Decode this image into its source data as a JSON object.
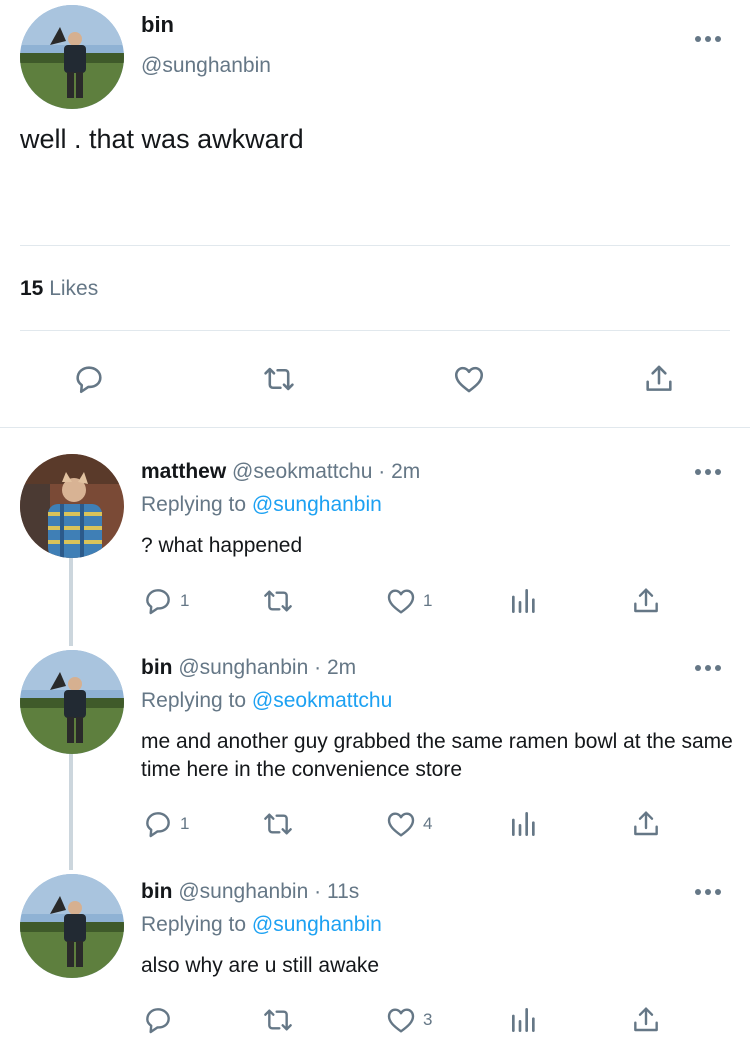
{
  "main_tweet": {
    "name": "bin",
    "handle": "@sunghanbin",
    "text": "well . that was awkward",
    "likes_count": "15",
    "likes_label": "Likes"
  },
  "replies": [
    {
      "name": "matthew",
      "handle": "@seokmattchu",
      "separator": "·",
      "time": "2m",
      "replying_prefix": "Replying to",
      "replying_to": "@sunghanbin",
      "text": "? what happened",
      "reply_count": "1",
      "like_count": "1"
    },
    {
      "name": "bin",
      "handle": "@sunghanbin",
      "separator": "·",
      "time": "2m",
      "replying_prefix": "Replying to",
      "replying_to": "@seokmattchu",
      "text": "me and another guy grabbed the same ramen bowl at the same time here in the convenience store",
      "reply_count": "1",
      "like_count": "4"
    },
    {
      "name": "bin",
      "handle": "@sunghanbin",
      "separator": "·",
      "time": "11s",
      "replying_prefix": "Replying to",
      "replying_to": "@sunghanbin",
      "text": "also why are u still awake",
      "reply_count": "",
      "like_count": "3"
    }
  ],
  "colors": {
    "text": "#14171a",
    "secondary": "#657786",
    "link": "#1da1f2",
    "divider": "#e1e8ed"
  }
}
